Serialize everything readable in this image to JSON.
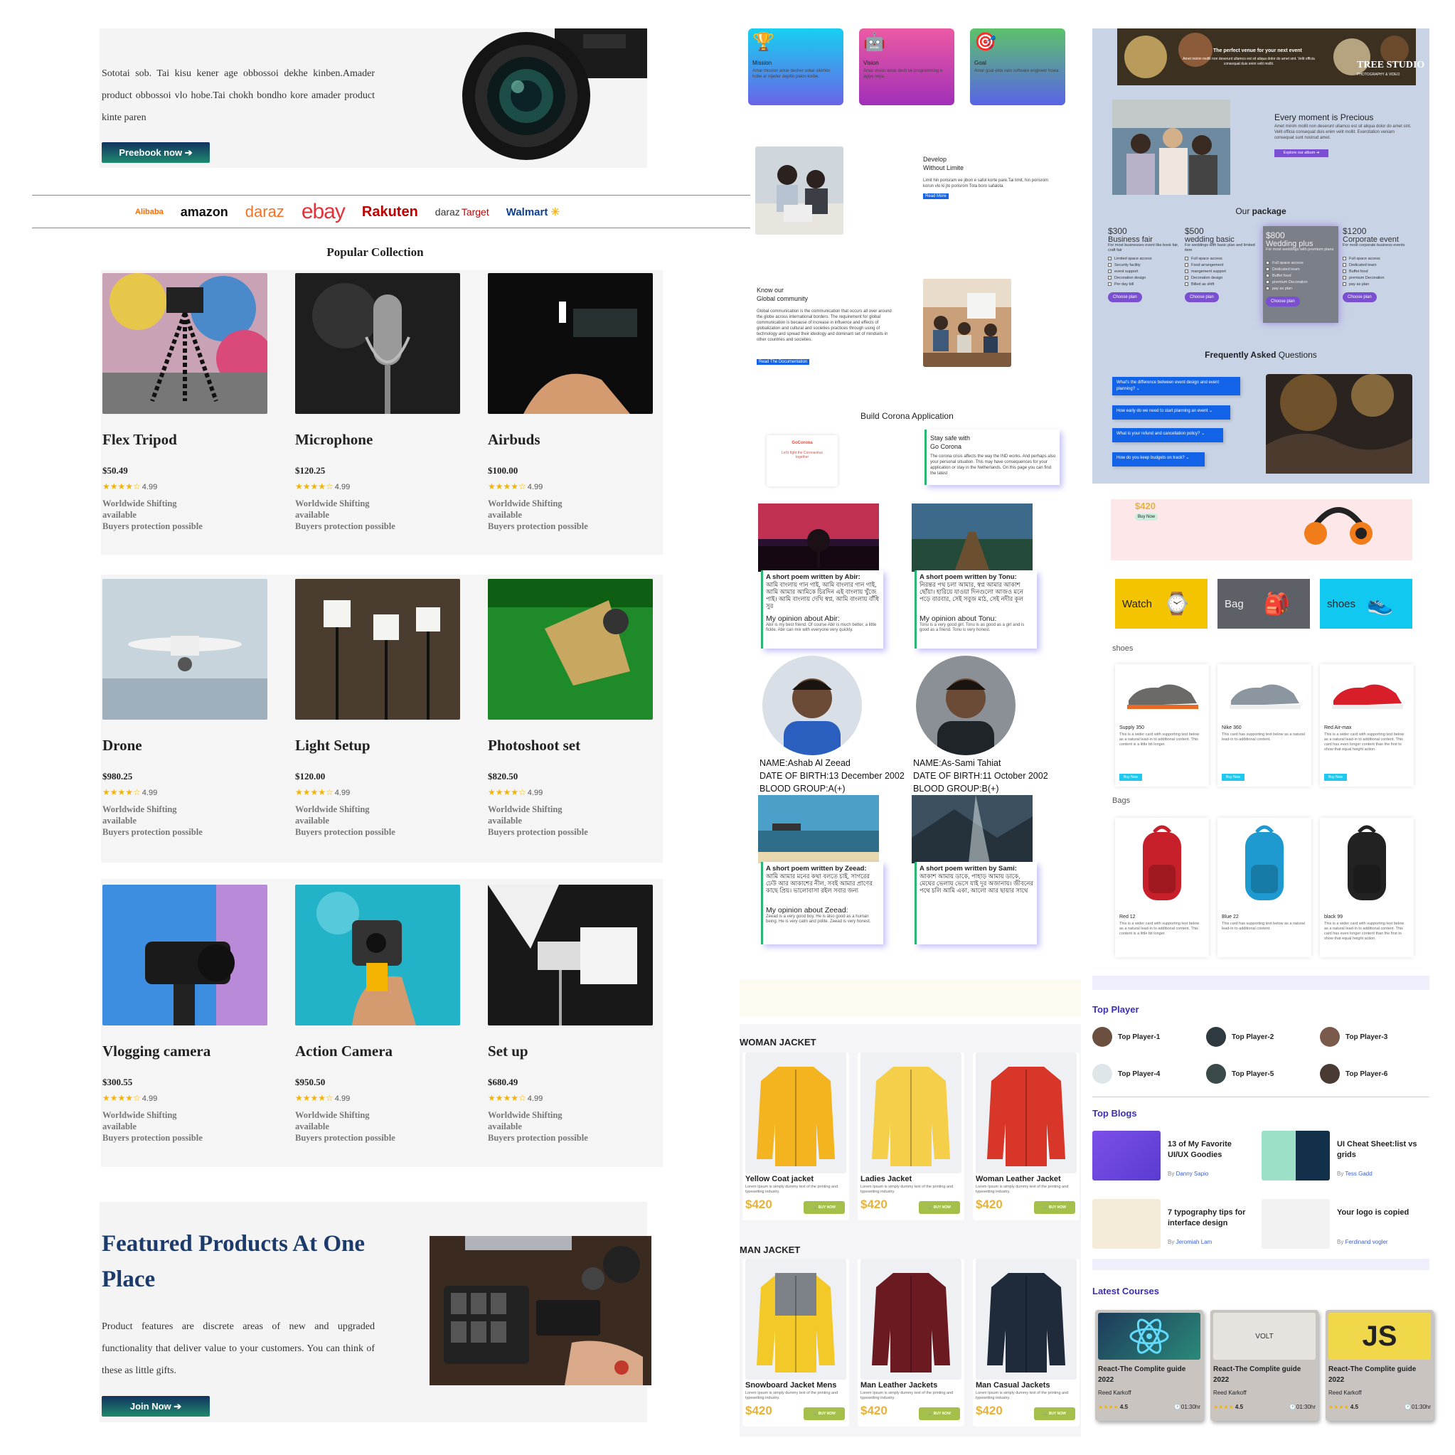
{
  "col1": {
    "hero": {
      "text": "Sototai sob. Tai kisu kener age obbossoi dekhe kinben.Amader product obbossoi vlo hobe.Tai chokh bondho kore amader product kinte paren",
      "button": "Preebook now ➔"
    },
    "brands": [
      "Alibaba",
      "amazon",
      "daraz",
      "ebay",
      "Rakuten",
      "daraz",
      "Target",
      "Walmart"
    ],
    "popular_title": "Popular Collection",
    "products": [
      {
        "name": "Flex Tripod",
        "price": "$50.49",
        "rating": "4.99"
      },
      {
        "name": "Microphone",
        "price": "$120.25",
        "rating": "4.99"
      },
      {
        "name": "Airbuds",
        "price": "$100.00",
        "rating": "4.99"
      },
      {
        "name": "Drone",
        "price": "$980.25",
        "rating": "4.99"
      },
      {
        "name": "Light Setup",
        "price": "$120.00",
        "rating": "4.99"
      },
      {
        "name": "Photoshoot set",
        "price": "$820.50",
        "rating": "4.99"
      },
      {
        "name": "Vlogging camera",
        "price": "$300.55",
        "rating": "4.99"
      },
      {
        "name": "Action Camera",
        "price": "$950.50",
        "rating": "4.99"
      },
      {
        "name": "Set up",
        "price": "$680.49",
        "rating": "4.99"
      }
    ],
    "product_info_1": "Worldwide Shifting",
    "product_info_2": "available",
    "product_info_3": "Buyers protection possible",
    "featured": {
      "title": "Featured Products At One Place",
      "text": "Product features are discrete areas of new and upgraded functionality that deliver value to your customers. You can think of these as little gifts.",
      "button": "Join Now ➔"
    }
  },
  "col2": {
    "cards": [
      {
        "title": "Mission",
        "text": "Amar mission amar desher sobai sikkhito hobe ar nijeder dayitto palon korbe."
      },
      {
        "title": "Vision",
        "text": "Amar vision amar desh ke programming e agiye neya."
      },
      {
        "title": "Goal",
        "text": "Amar goal ekta valo software engineer howa."
      }
    ],
    "develop": {
      "title1": "Develop",
      "title2": "Without Limite",
      "text": "Limit hin porisram ee jibon e safol korte pare.Tai limit, hin porisrom korun vlo ki jto porisrom Tota boro safalota",
      "button": "Read More"
    },
    "community": {
      "title1": "Know our",
      "title2": "Global community",
      "text": "Global communication is the communication that occurs all over around the globe across international borders. The requirement for global communication is because of increase in influence and effects of globalization and cultural and societies practices through using of technology and spread their ideology and dominant set of mindsets in other countries and societies.",
      "button": "Read The Documentation"
    },
    "corona": {
      "title": "Build Corona Application",
      "app": "GoCorona",
      "app_tag": "Let's fight the Coronavirus together",
      "card_title1": "Stay safe with",
      "card_title2": "Go Corona",
      "card_text": "The corona crisis affects the way the IND works. And perhaps also your personal situation. This may have consequences for your application or stay in the Netherlands. On this page you can find the latest"
    },
    "poems": [
      {
        "title": "A short poem written by Abir:",
        "poem": "আমি বাংলায় গান গাই, আমি বাংলার গান গাই, আমি আমার আমিকে চিরদিন এই বাংলায় খুঁজে পাই। আমি বাংলায় দেখি স্বপ্ন, আমি বাংলায় বাঁধি সুর",
        "opinion": "My opinion about Abir:",
        "opinion_text": "Abir is my best friend. Of course Abir is much better, a little fickle. Abir can mix with everyone very quickly."
      },
      {
        "title": "A short poem written by Tonu:",
        "poem": "নিরন্তর পথ চলা আমার, স্বপ্ন আমার আকাশ ছোঁয়া। হারিয়ে যাওয়া দিনগুলো আজও মনে পড়ে বারবার, সেই সবুজ মাঠ, সেই নদীর কূল",
        "opinion": "My opinion about Tonu:",
        "opinion_text": "Tonu is a very good girl. Tonu is as good as a girl and is good as a friend. Tonu is very honest."
      },
      {
        "title": "A short poem written by Zeead:",
        "poem": "আমি আমার মনের কথা বলতে চাই, সাগরের ঢেউ আর আকাশের নীল, সবই আমার প্রাণের কাছে প্রিয়। ভালোবাসা রইল সবার জন্য",
        "opinion": "My opinion about Zeead:",
        "opinion_text": "Zeead is a very good boy. He is also good as a human being. He is very calm and polite. Zeead is very honest."
      },
      {
        "title": "A short poem written by Sami:",
        "poem": "আকাশ আমায় ডাকে, পাহাড় আমায় ডাকে, মেঘের ভেলায় ভেসে যাই দূর অজানায়। জীবনের পথে চলি আমি একা, আলো আর ছায়ার সাথে",
        "opinion": "",
        "opinion_text": ""
      }
    ],
    "persons": [
      {
        "name": "NAME:Ashab Al Zeead",
        "dob": "DATE OF BIRTH:13 December 2002",
        "blood": "BLOOD GROUP:A(+)"
      },
      {
        "name": "NAME:As-Sami Tahiat",
        "dob": "DATE OF BIRTH:11 October 2002",
        "blood": "BLOOD GROUP:B(+)"
      }
    ],
    "woman_title": "WOMAN JACKET",
    "woman": [
      {
        "name": "Yellow Coat jacket",
        "price": "$420"
      },
      {
        "name": "Ladies Jacket",
        "price": "$420"
      },
      {
        "name": "Woman Leather Jacket",
        "price": "$420"
      }
    ],
    "man_title": "MAN JACKET",
    "man": [
      {
        "name": "Snowboard Jacket Mens",
        "price": "$420"
      },
      {
        "name": "Man Leather Jackets",
        "price": "$420"
      },
      {
        "name": "Man Casual Jackets",
        "price": "$420"
      }
    ],
    "jacket_desc": "Lorem Ipsum is simply dummy text of the printing and typesetting industry.",
    "jacket_btn": "🛒 BUY NOW"
  },
  "col3": {
    "hero": {
      "tagline": "The perfect venue for your next event",
      "sub": "Amet minim mollit non deserunt ullamco est sit aliqua dolor do amet sint. Velit officia consequat duis enim velit mollit.",
      "logo": "TREE STUDIO",
      "logo_sub": "PHOTOGRAPHY & VIDEO"
    },
    "moment": {
      "title": "Every moment is Precious",
      "text": "Amet minim mollit non deserunt ullamco est sit aliqua dolor do amet sint. Velit officia consequat duis enim velit mollit. Exercitation veniam consequat sunt nostrud amet.",
      "button": "Explore our album ➔"
    },
    "package_title_a": "Our ",
    "package_title_b": "package",
    "plans": [
      {
        "price": "$300",
        "name": "Business fair",
        "desc": "For most businesses event like book fair, craft fair",
        "items": [
          "Limited space access",
          "Security facility",
          "event support",
          "Decoration design",
          "Per day bill"
        ]
      },
      {
        "price": "$500",
        "name": "wedding basic",
        "desc": "For weddings with basic plan and limited item",
        "items": [
          "Full space access",
          "Food arrangement",
          "mangement support",
          "Decoration design",
          "Billed as shift"
        ]
      },
      {
        "price": "$800",
        "name": "Wedding plus",
        "desc": "For most weddings with premium plans",
        "items": [
          "Full space access",
          "Dedicated team",
          "Buffet food",
          "premium Decoration",
          "pay as plan"
        ]
      },
      {
        "price": "$1200",
        "name": "Corporate event",
        "desc": "For most corporate business events",
        "items": [
          "Full space access",
          "Dedicated team",
          "Buffet food",
          "premium Decoration",
          "pay as plan"
        ]
      }
    ],
    "plan_button": "Choose plan",
    "faq_title_a": "Frequently ",
    "faq_title_b": "Asked",
    "faq_title_c": " Questions",
    "faqs": [
      "What's the difference between event design and event planning? ⌄",
      "How early do we need to start planning an event ⌄",
      "What is your refund and cancellation policy? ⌄",
      "How do you keep budgets on track? ⌄"
    ],
    "headphone": {
      "price": "$420",
      "button": "Buy Now"
    },
    "categories": [
      "Watch",
      "Bag",
      "shoes"
    ],
    "shoes_title": "shoes",
    "shoes": [
      {
        "name": "Supply 350",
        "desc": "This is a wider card with supporting text below as a natural lead-in to additional content. This content is a little bit longer."
      },
      {
        "name": "Nike 360",
        "desc": "This card has supporting text below as a natural lead-in to additional content."
      },
      {
        "name": "Red Air-max",
        "desc": "This is a wider card with supporting text below as a natural lead-in to additional content. This card has even longer content than the first to show that equal height action."
      }
    ],
    "bags_title": "Bags",
    "bags": [
      {
        "name": "Red 12",
        "desc": "This is a wider card with supporting text below as a natural lead-in to additional content. This content is a little bit longer."
      },
      {
        "name": "Blue 22",
        "desc": "This card has supporting text below as a natural lead-in to additional content."
      },
      {
        "name": "black 99",
        "desc": "This is a wider card with supporting text below as a natural lead-in to additional content. This card has even longer content than the first to show that equal height action."
      }
    ],
    "buy_now": "Buy Now",
    "top_player_title": "Top Player",
    "players": [
      "Top Player-1",
      "Top Player-2",
      "Top Player-3",
      "Top Player-4",
      "Top Player-5",
      "Top Player-6"
    ],
    "top_blogs_title": "Top Blogs",
    "blogs": [
      {
        "title": "13 of My Favorite UI/UX Goodies",
        "by": "By ",
        "author": "Danny Sapio"
      },
      {
        "title": "UI Cheat Sheet:list vs grids",
        "by": "By ",
        "author": "Tess Gadd"
      },
      {
        "title": "7 typography tips for interface design",
        "by": "By ",
        "author": "Jeromiah Lam"
      },
      {
        "title": "Your logo is copied",
        "by": "By ",
        "author": "Ferdinand vogler"
      }
    ],
    "courses_title": "Latest Courses",
    "courses": [
      {
        "title": "React-The Complite guide 2022",
        "author": "Reed Karkoff",
        "rating": "4.5",
        "duration": "🕑01:30hr"
      },
      {
        "title": "React-The Complite guide 2022",
        "author": "Reed Karkoff",
        "rating": "4.5",
        "duration": "🕑01:30hr"
      },
      {
        "title": "React-The Complite guide 2022",
        "author": "Reed Karkoff",
        "rating": "4.5",
        "duration": "🕑01:30hr"
      }
    ],
    "course_img_label_2": "VOLT",
    "course_img_label_3": "JS"
  },
  "colors": {
    "navy": "#12325f",
    "teal": "#1e8a6e",
    "purple": "#7b4fd1",
    "blue": "#1363e8",
    "gold": "#e8b23a",
    "green_btn": "#a5c04a",
    "cyan": "#1ec8ef",
    "yellow_cat": "#f5c400",
    "grey_cat": "#5d6066",
    "cyan_cat": "#10c8f0"
  }
}
